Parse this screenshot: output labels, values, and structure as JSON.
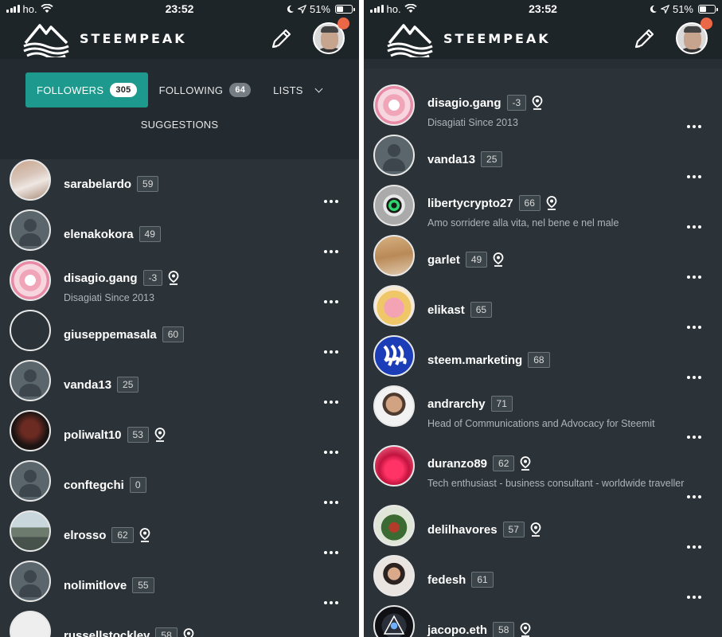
{
  "status_bar": {
    "carrier": "ho.",
    "time": "23:52",
    "battery": "51%"
  },
  "header": {
    "logo_text": "STEEMPEAK"
  },
  "tabs": {
    "followers_label": "FOLLOWERS",
    "followers_count": "305",
    "following_label": "FOLLOWING",
    "following_count": "64",
    "lists_label": "LISTS",
    "suggestions_label": "SUGGESTIONS"
  },
  "left_list": [
    {
      "name": "sarabelardo",
      "rep": "59",
      "bio": "",
      "location": false,
      "avatar": "av-photo1"
    },
    {
      "name": "elenakokora",
      "rep": "49",
      "bio": "",
      "location": false,
      "avatar": "placeholder"
    },
    {
      "name": "disagio.gang",
      "rep": "-3",
      "bio": "Disagiati Since 2013",
      "location": true,
      "avatar": "av-pink"
    },
    {
      "name": "giuseppemasala",
      "rep": "60",
      "bio": "",
      "location": false,
      "avatar": "empty"
    },
    {
      "name": "vanda13",
      "rep": "25",
      "bio": "",
      "location": false,
      "avatar": "placeholder"
    },
    {
      "name": "poliwalt10",
      "rep": "53",
      "bio": "",
      "location": true,
      "avatar": "av-dark"
    },
    {
      "name": "conftegchi",
      "rep": "0",
      "bio": "",
      "location": false,
      "avatar": "placeholder"
    },
    {
      "name": "elrosso",
      "rep": "62",
      "bio": "",
      "location": true,
      "avatar": "av-lake"
    },
    {
      "name": "nolimitlove",
      "rep": "55",
      "bio": "",
      "location": false,
      "avatar": "placeholder"
    },
    {
      "name": "russellstockley",
      "rep": "58",
      "bio": "",
      "location": true,
      "avatar": "av-partial"
    }
  ],
  "right_list": [
    {
      "name": "disagio.gang",
      "rep": "-3",
      "bio": "Disagiati Since 2013",
      "location": true,
      "avatar": "av-pink"
    },
    {
      "name": "vanda13",
      "rep": "25",
      "bio": "",
      "location": false,
      "avatar": "placeholder"
    },
    {
      "name": "libertycrypto27",
      "rep": "66",
      "bio": "Amo sorridere alla vita, nel bene e nel male",
      "location": true,
      "avatar": "av-eye"
    },
    {
      "name": "garlet",
      "rep": "49",
      "bio": "",
      "location": true,
      "avatar": "av-dog"
    },
    {
      "name": "elikast",
      "rep": "65",
      "bio": "",
      "location": false,
      "avatar": "av-cartoon"
    },
    {
      "name": "steem.marketing",
      "rep": "68",
      "bio": "",
      "location": false,
      "avatar": "av-steem"
    },
    {
      "name": "andrarchy",
      "rep": "71",
      "bio": "Head of Communications and Advocacy for Steemit",
      "location": false,
      "avatar": "av-man"
    },
    {
      "name": "duranzo89",
      "rep": "62",
      "bio": "Tech enthusiast - business consultant - worldwide traveller",
      "location": true,
      "avatar": "av-red"
    },
    {
      "name": "delilhavores",
      "rep": "57",
      "bio": "",
      "location": true,
      "avatar": "av-tree"
    },
    {
      "name": "fedesh",
      "rep": "61",
      "bio": "",
      "location": false,
      "avatar": "av-girl"
    },
    {
      "name": "jacopo.eth",
      "rep": "58",
      "bio": "",
      "location": true,
      "avatar": "av-dark2"
    }
  ]
}
